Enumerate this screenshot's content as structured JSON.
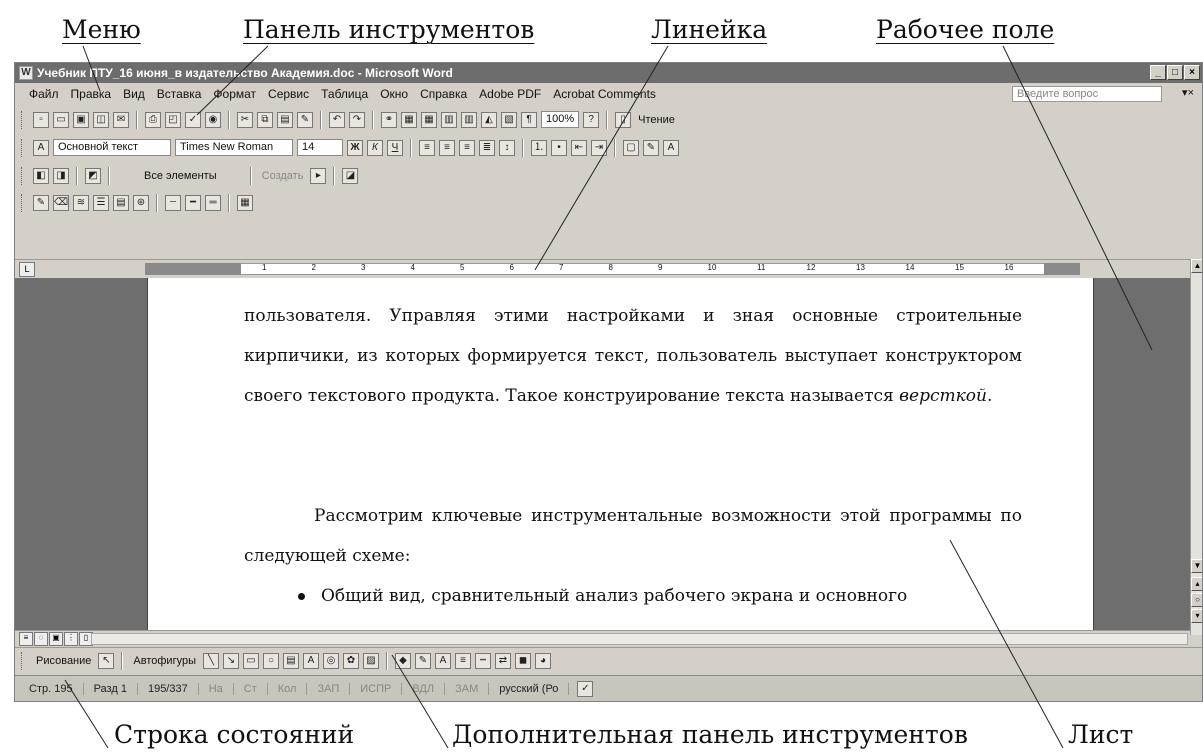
{
  "callouts": {
    "menu": "Меню",
    "toolbar": "Панель инструментов",
    "ruler": "Линейка",
    "workspace": "Рабочее поле",
    "statusbar": "Строка состояний",
    "extra_toolbar": "Дополнительная панель инструментов",
    "sheet": "Лист"
  },
  "window": {
    "title": "Учебник ПТУ_16 июня_в издательство Академия.doc - Microsoft Word"
  },
  "menu": {
    "items": [
      "Файл",
      "Правка",
      "Вид",
      "Вставка",
      "Формат",
      "Сервис",
      "Таблица",
      "Окно",
      "Справка",
      "Adobe PDF",
      "Acrobat Comments"
    ],
    "ask_placeholder": "Введите вопрос"
  },
  "toolbar_standard": {
    "zoom": "100%",
    "reading": "Чтение"
  },
  "toolbar_formatting": {
    "style": "Основной текст",
    "font": "Times New Roman",
    "size": "14"
  },
  "toolbar_reviewing": {
    "all_elements": "Все элементы",
    "create": "Создать"
  },
  "ruler": {
    "ticks": [
      "1",
      "2",
      "3",
      "4",
      "5",
      "6",
      "7",
      "8",
      "9",
      "10",
      "11",
      "12",
      "13",
      "14",
      "15",
      "16"
    ]
  },
  "document": {
    "para1": "пользователя. Управляя этими настройками и зная основные строительные кирпичики, из которых  формируется текст, пользователь выступает конструктором своего текстового продукта. Такое конструирование текста называется ",
    "para1_italic": "версткой",
    "para1_end": ".",
    "para2": "Рассмотрим ключевые инструментальные возможности этой программы по следующей схеме:",
    "bullet1": "Общий вид, сравнительный анализ рабочего экрана и основного"
  },
  "drawing_toolbar": {
    "draw": "Рисование",
    "autoshapes": "Автофигуры"
  },
  "statusbar": {
    "page": "Стр. 195",
    "section": "Разд 1",
    "pages": "195/337",
    "at": "На",
    "line": "Ст",
    "col": "Кол",
    "rec": "ЗАП",
    "trk": "ИСПР",
    "ext": "ВДЛ",
    "ovr": "ЗАМ",
    "lang": "русский (Ро"
  },
  "colors": {
    "titlebar": "#6d6d6d",
    "chrome": "#d4d0c8",
    "doc_background": "#6e6e6e",
    "page": "#ffffff"
  }
}
